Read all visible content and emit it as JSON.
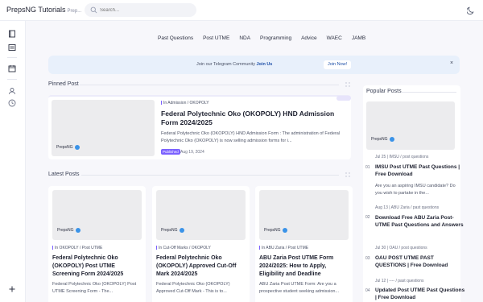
{
  "header": {
    "brand": "PrepsNG Tutorials",
    "brand_suffix": "Prep...",
    "search_placeholder": "Search..."
  },
  "rail": {
    "icons": [
      "book-icon",
      "news-icon",
      "calendar-icon",
      "users-icon",
      "clock-icon",
      "plus-icon"
    ]
  },
  "menu": [
    "Past Questions",
    "Post UTME",
    "NDA",
    "Programming",
    "Advice",
    "WAEC",
    "JAMB"
  ],
  "banner": {
    "text": "Join our Telegram Community",
    "link": "Join Us",
    "button": "Join Now!",
    "close": "×"
  },
  "pinned": {
    "label": "Pinned Post",
    "author": "PrepsNG",
    "category": "In Admission / OKOPOLY",
    "title": "Federal Polytechnic Oko (OKOPOLY) HND Admission Form 2024/2025",
    "excerpt": "Federal Polytechnic Oko (OKOPOLY) HND Admission Form : The administration of Federal Polytechnic Oko (OKOPOLY) is now selling admission forms for i...",
    "tag": "Published",
    "date": "Aug 19, 2024"
  },
  "latest": {
    "label": "Latest Posts",
    "posts": [
      {
        "author": "PrepsNG",
        "category": "In OKOPOLY / Post UTME",
        "title": "Federal Polytechnic Oko (OKOPOLY) Post UTME Screening Form 2024/2025",
        "excerpt": "Federal Polytechnic Oko (OKOPOLY) Post UTME Screening Form - The..."
      },
      {
        "author": "PrepsNG",
        "category": "In Cut-Off Marks / OKOPOLY",
        "title": "Federal Polytechnic Oko (OKOPOLY) Approved Cut-Off Mark 2024/2025",
        "excerpt": "Federal Polytechnic Oko (OKOPOLY) Approved Cut-Off Mark - This is to..."
      },
      {
        "author": "PrepsNG",
        "category": "In ABU Zaria / Post UTME",
        "title": "ABU Zaria Post UTME Form 2024/2025: How to Apply, Eligibility and Deadline",
        "excerpt": "ABU Zaria Post UTME Form: Are you a prospective student seeking admission..."
      }
    ]
  },
  "popular": {
    "label": "Popular Posts",
    "author": "PrepsNG",
    "items": [
      {
        "num": "01",
        "meta": "Jul 25  |  IMSU / post questions",
        "title": "IMSU Post UTME Past Questions | Free Download",
        "excerpt": "Are you an aspiring IMSU candidate? Do you wish to partake in the..."
      },
      {
        "num": "02",
        "meta": "Aug 13  |  ABU Zaria / past questions",
        "title": "Download Free ABU Zaria Post-UTME Past Questions and Answers",
        "excerpt": ""
      },
      {
        "num": "03",
        "meta": "Jul 30  |  OAU / post questions",
        "title": "OAU POST UTME PAST QUESTIONS | Free Download",
        "excerpt": ""
      },
      {
        "num": "04",
        "meta": "Jul 12  |  ---- / past questions",
        "title": "Updated Post UTME Past Questions | Free Download",
        "excerpt": ""
      }
    ]
  }
}
